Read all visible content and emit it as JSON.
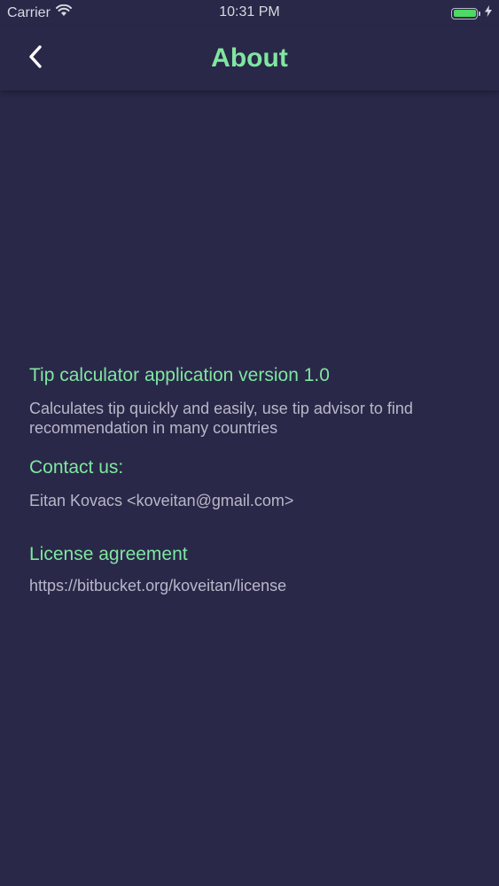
{
  "status_bar": {
    "carrier": "Carrier",
    "time": "10:31 PM",
    "wifi_icon": "wifi-icon",
    "battery_icon": "battery-icon",
    "charging_icon": "bolt-icon",
    "battery_color": "#4cd964"
  },
  "nav": {
    "title": "About",
    "back_icon": "chevron-left-icon"
  },
  "content": {
    "version_heading": "Tip calculator application version 1.0",
    "description": "Calculates tip quickly and easily, use tip advisor to find recommendation in many countries",
    "contact_heading": "Contact us:",
    "contact_text": "Eitan Kovacs <koveitan@gmail.com>",
    "license_heading": "License agreement",
    "license_url": "https://bitbucket.org/koveitan/license"
  },
  "colors": {
    "background": "#2a2848",
    "accent": "#7fe6a1",
    "body_text": "#b8b7c9"
  }
}
